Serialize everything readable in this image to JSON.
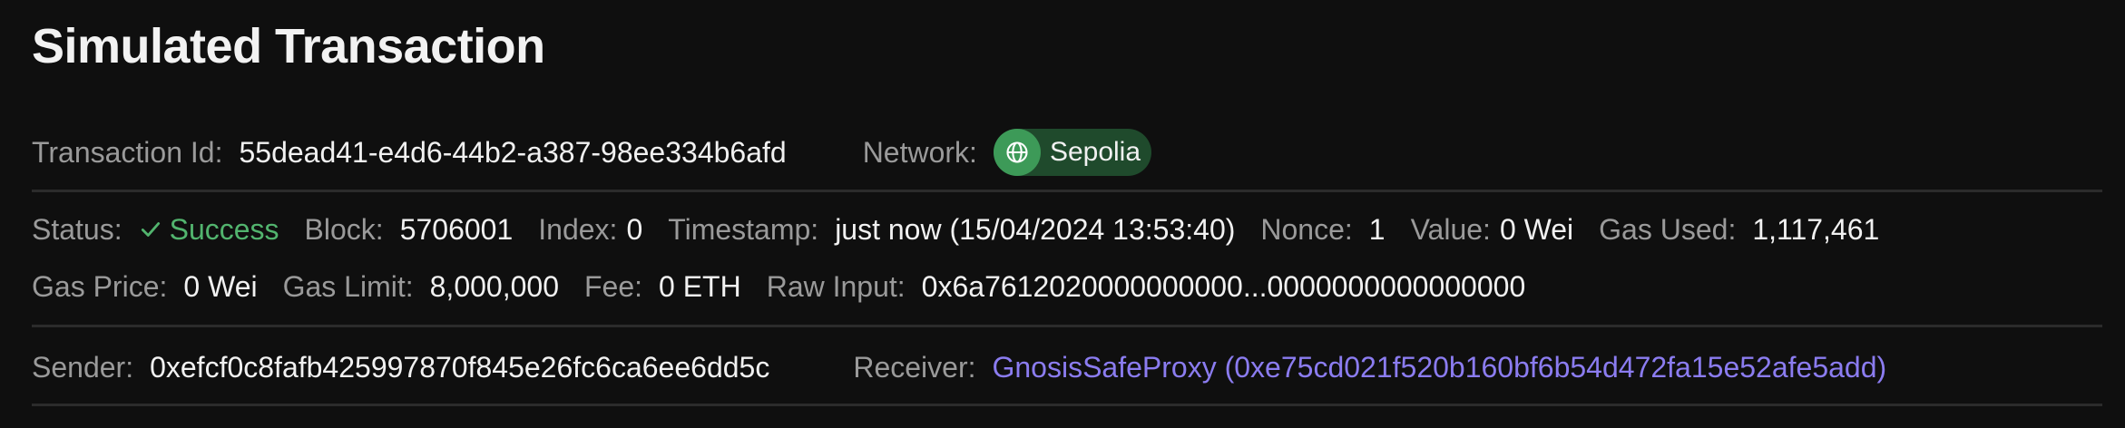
{
  "title": "Simulated Transaction",
  "transaction": {
    "id_label": "Transaction Id:",
    "id_value": "55dead41-e4d6-44b2-a387-98ee334b6afd",
    "network_label": "Network:",
    "network_name": "Sepolia",
    "network_icon": "globe-icon"
  },
  "details": {
    "status_label": "Status:",
    "status_value": "Success",
    "status_icon": "check-icon",
    "block_label": "Block:",
    "block_value": "5706001",
    "index_label": "Index:",
    "index_value": "0",
    "timestamp_label": "Timestamp:",
    "timestamp_value": "just now (15/04/2024 13:53:40)",
    "nonce_label": "Nonce:",
    "nonce_value": "1",
    "value_label": "Value:",
    "value_value": "0 Wei",
    "gas_used_label": "Gas Used:",
    "gas_used_value": "1,117,461",
    "gas_price_label": "Gas Price:",
    "gas_price_value": "0 Wei",
    "gas_limit_label": "Gas Limit:",
    "gas_limit_value": "8,000,000",
    "fee_label": "Fee:",
    "fee_value": "0 ETH",
    "raw_input_label": "Raw Input:",
    "raw_input_value": "0x6a7612020000000000...0000000000000000"
  },
  "parties": {
    "sender_label": "Sender:",
    "sender_value": "0xefcf0c8fafb425997870f845e26fc6ca6ee6dd5c",
    "receiver_label": "Receiver:",
    "receiver_value": "GnosisSafeProxy (0xe75cd021f520b160bf6b54d472fa15e52afe5add)"
  },
  "colors": {
    "background": "#0f0f0f",
    "success": "#52b46e",
    "link": "#8b7cf0",
    "network_badge": "#1f4a2c",
    "network_icon_bg": "#3d9a58"
  }
}
